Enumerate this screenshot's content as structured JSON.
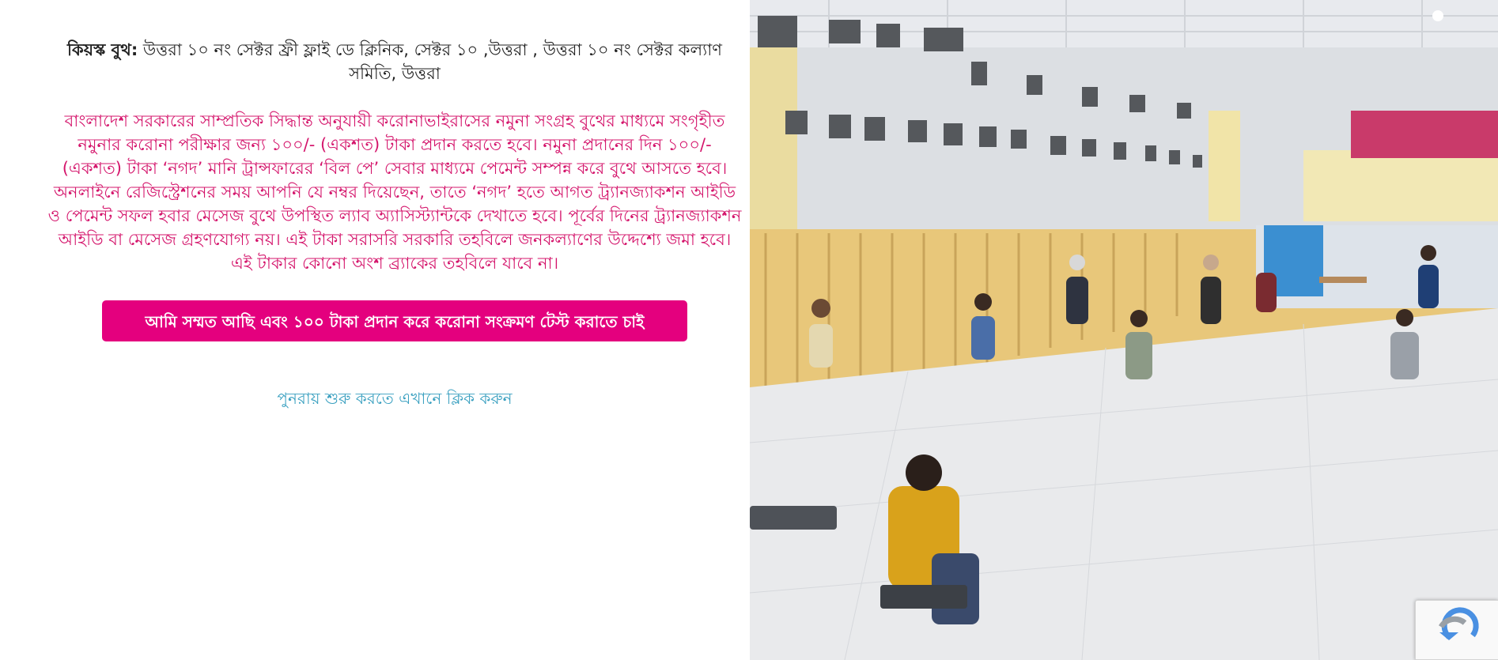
{
  "kiosk": {
    "label": "কিয়স্ক বুথ:",
    "location": " উত্তরা ১০ নং সেক্টর ফ্রী ফ্লাই ডে ক্লিনিক, সেক্টর ১০ ,উত্তরা , উত্তরা ১০ নং সেক্টর কল্যাণ সমিতি, উত্তরা"
  },
  "notice": "বাংলাদেশ সরকারের সাম্প্রতিক সিদ্ধান্ত অনুযায়ী করোনাভাইরাসের নমুনা সংগ্রহ বুথের মাধ্যমে সংগৃহীত নমুনার করোনা পরীক্ষার জন্য ১০০/- (একশত) টাকা প্রদান করতে হবে। নমুনা প্রদানের দিন ১০০/- (একশত) টাকা ‘নগদ’ মানি ট্রান্সফারের ‘বিল পে’ সেবার মাধ্যমে পেমেন্ট সম্পন্ন করে বুথে আসতে হবে। অনলাইনে রেজিস্ট্রেশনের সময় আপনি যে নম্বর দিয়েছেন, তাতে ‘নগদ’ হতে আগত ট্র্যানজ্যাকশন আইডি ও পেমেন্ট সফল হবার মেসেজ বুথে উপস্থিত ল্যাব অ্যাসিস্ট্যান্টকে দেখাতে হবে। পূর্বের দিনের ট্র্যানজ্যাকশন আইডি বা মেসেজ গ্রহণযোগ্য নয়। এই টাকা সরাসরি সরকারি তহবিলে জনকল্যাণের উদ্দেশ্যে জমা হবে। এই টাকার কোনো অংশ ব্র্যাকের তহবিলে যাবে না।",
  "consent_button": "আমি সম্মত আছি এবং ১০০ টাকা প্রদান করে করোনা সংক্রমণ টেস্ট করাতে চাই",
  "restart_link": "পুনরায় শুরু করতে এখানে ক্লিক করুন",
  "colors": {
    "notice_text": "#d4146b",
    "button_bg": "#e4007e",
    "link": "#3aa0c0"
  }
}
